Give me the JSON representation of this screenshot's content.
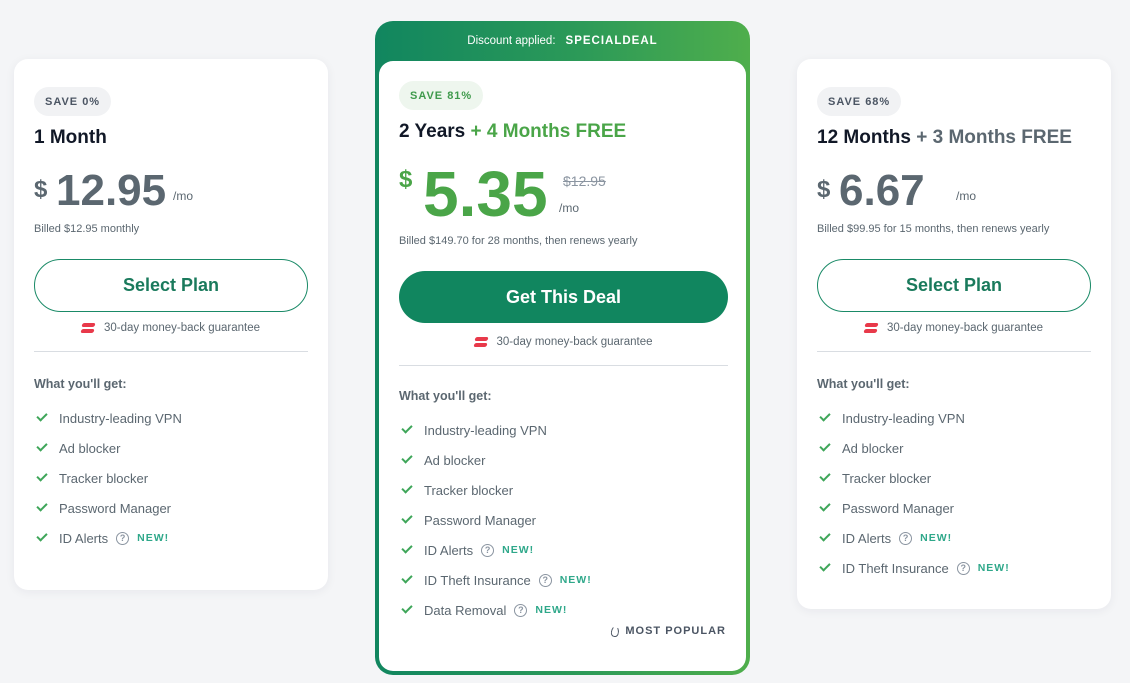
{
  "plans": {
    "monthly": {
      "save": "SAVE 0%",
      "title": "1 Month",
      "bonus": "",
      "currency": "$",
      "amount": "12.95",
      "per": "/mo",
      "billed": "Billed $12.95 monthly",
      "button": "Select Plan",
      "guarantee": "30-day money-back guarantee",
      "features_heading": "What you'll get:",
      "features": [
        "Industry-leading VPN",
        "Ad blocker",
        "Tracker blocker",
        "Password Manager",
        "ID Alerts"
      ],
      "new_label": "NEW!"
    },
    "featured": {
      "banner_label": "Discount applied:",
      "banner_code": "SPECIALDEAL",
      "save": "SAVE 81%",
      "title": "2 Years",
      "bonus": "+ 4 Months FREE",
      "currency": "$",
      "amount": "5.35",
      "old_price": "$12.95",
      "per": "/mo",
      "billed": "Billed $149.70 for 28 months, then renews yearly",
      "button": "Get This Deal",
      "guarantee": "30-day money-back guarantee",
      "features_heading": "What you'll get:",
      "features": [
        "Industry-leading VPN",
        "Ad blocker",
        "Tracker blocker",
        "Password Manager",
        "ID Alerts",
        "ID Theft Insurance",
        "Data Removal"
      ],
      "new_label": "NEW!",
      "most_popular": "MOST POPULAR"
    },
    "annual": {
      "save": "SAVE 68%",
      "title": "12 Months",
      "bonus": "+ 3 Months FREE",
      "currency": "$",
      "amount": "6.67",
      "per": "/mo",
      "billed": "Billed $99.95 for 15 months, then renews yearly",
      "button": "Select Plan",
      "guarantee": "30-day money-back guarantee",
      "features_heading": "What you'll get:",
      "features": [
        "Industry-leading VPN",
        "Ad blocker",
        "Tracker blocker",
        "Password Manager",
        "ID Alerts",
        "ID Theft Insurance"
      ],
      "new_label": "NEW!"
    }
  },
  "colors": {
    "brand_green": "#11865f",
    "accent_green": "#4aa548",
    "price_gray": "#5b6770",
    "new_badge": "#2fa88a",
    "guarantee_red": "#e8394a"
  },
  "icons": {
    "check": "check-icon",
    "help": "help-icon",
    "guarantee": "money-back-icon",
    "popular": "flame-icon"
  }
}
